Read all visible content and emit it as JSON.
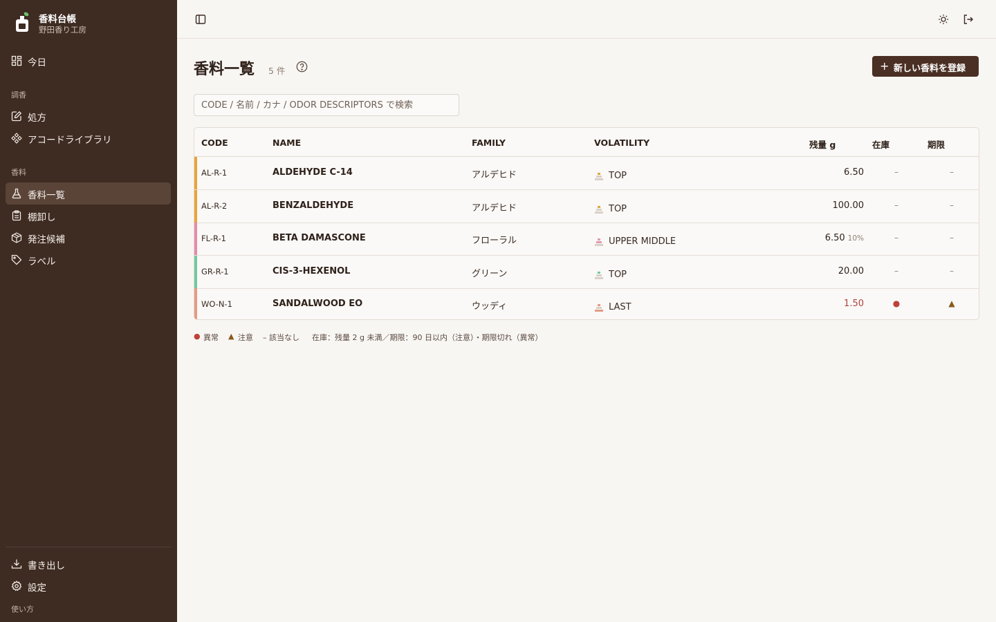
{
  "brand": {
    "name": "香料台帳",
    "subtitle": "野田香り工房"
  },
  "sidebar": {
    "today": "今日",
    "section_blending": "調香",
    "formula": "処方",
    "accord_library": "アコードライブラリ",
    "section_perfume": "香料",
    "perfume_list": "香料一覧",
    "inventory": "棚卸し",
    "order_candidates": "発注候補",
    "labels": "ラベル",
    "export": "書き出し",
    "settings": "設定",
    "usage": "使い方"
  },
  "page": {
    "title": "香料一覧",
    "count": "5 件",
    "new_button": "新しい香料を登録",
    "search_placeholder": "CODE / 名前 / カナ / ODOR DESCRIPTORS で検索"
  },
  "table": {
    "headers": {
      "code": "CODE",
      "name": "NAME",
      "family": "FAMILY",
      "volatility": "VOLATILITY",
      "remaining": "残量 g",
      "stock": "在庫",
      "expiry": "期限"
    },
    "rows": [
      {
        "code": "AL-R-1",
        "name": "ALDEHYDE C-14",
        "family": "アルデヒド",
        "volatility": "TOP",
        "remaining": "6.50",
        "percent": "",
        "stock": "–",
        "expiry": "–",
        "stripe": "#e8a33a",
        "vol_color": "#e0a640"
      },
      {
        "code": "AL-R-2",
        "name": "BENZALDEHYDE",
        "family": "アルデヒド",
        "volatility": "TOP",
        "remaining": "100.00",
        "percent": "",
        "stock": "–",
        "expiry": "–",
        "stripe": "#e8a33a",
        "vol_color": "#e0a640"
      },
      {
        "code": "FL-R-1",
        "name": "BETA DAMASCONE",
        "family": "フローラル",
        "volatility": "UPPER MIDDLE",
        "remaining": "6.50",
        "percent": "10%",
        "stock": "–",
        "expiry": "–",
        "stripe": "#e58cac",
        "vol_color": "#e29ab3"
      },
      {
        "code": "GR-R-1",
        "name": "CIS-3-HEXENOL",
        "family": "グリーン",
        "volatility": "TOP",
        "remaining": "20.00",
        "percent": "",
        "stock": "–",
        "expiry": "–",
        "stripe": "#6fcb9f",
        "vol_color": "#6fcb9f"
      },
      {
        "code": "WO-N-1",
        "name": "SANDALWOOD EO",
        "family": "ウッディ",
        "volatility": "LAST",
        "remaining": "1.50",
        "percent": "",
        "stock": "●",
        "expiry": "▲",
        "stripe": "#e59a86",
        "vol_color": "#e59a86"
      }
    ]
  },
  "legend": {
    "abnormal_symbol": "●",
    "abnormal": "異常",
    "caution_symbol": "▲",
    "caution": "注意",
    "none": "– 該当なし",
    "description": "在庫：残量 2 g 未満／期限：90 日以内（注意）・期限切れ（異常）"
  },
  "colors": {
    "sidebar_bg": "#3e2b22",
    "accent_button": "#4a2f24",
    "abnormal": "#c0403a",
    "caution": "#8a5a1a"
  },
  "icons": {
    "today": "grid-icon",
    "formula": "edit-icon",
    "accord_library": "diamond-cluster-icon",
    "perfume_list": "flask-icon",
    "inventory": "clipboard-icon",
    "order_candidates": "package-icon",
    "labels": "tag-icon",
    "export": "download-icon",
    "settings": "gear-icon",
    "toggle_sidebar": "panel-toggle-icon",
    "theme": "sun-icon",
    "logout": "logout-icon",
    "help": "question-circle-icon"
  }
}
